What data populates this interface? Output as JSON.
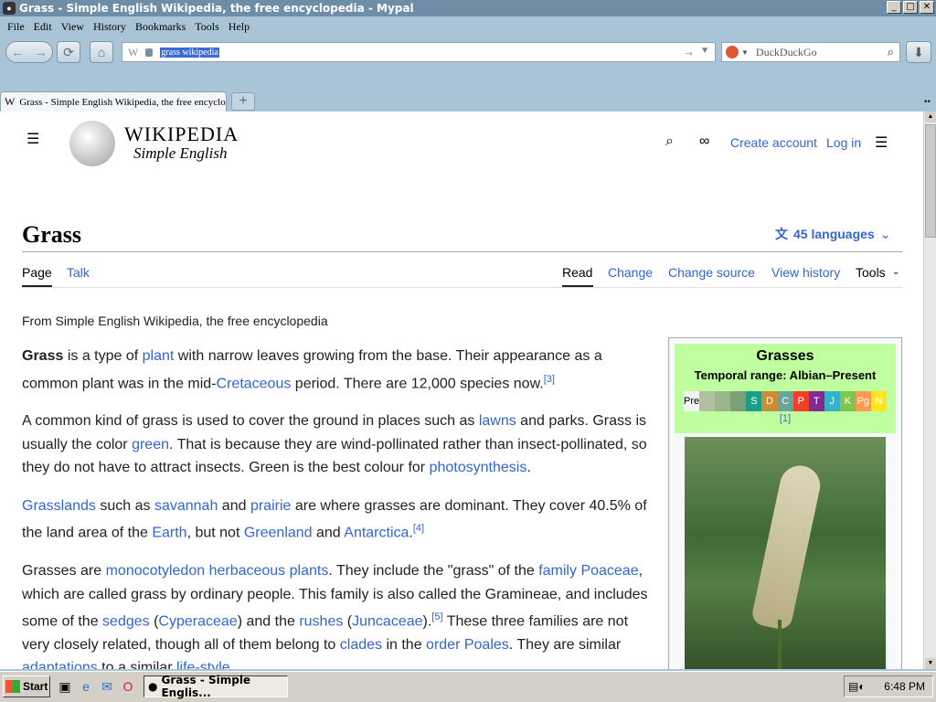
{
  "window": {
    "title": "Grass - Simple English Wikipedia, the free encyclopedia - Mypal",
    "controls": {
      "minimize": "_",
      "maximize": "□",
      "close": "✕"
    }
  },
  "menubar": {
    "items": [
      "File",
      "Edit",
      "View",
      "History",
      "Bookmarks",
      "Tools",
      "Help"
    ]
  },
  "navbar": {
    "url": "grass wikipedia",
    "site_icon": "W",
    "search_placeholder": "DuckDuckGo"
  },
  "tabs": [
    {
      "label": "Grass - Simple English Wikipedia, the free encyclopedia",
      "favicon": "W",
      "active": true
    }
  ],
  "wiki": {
    "wordmark": "WIKIPEDIA",
    "tagline": "Simple English",
    "header_links": {
      "create_account": "Create account",
      "login": "Log in"
    },
    "page_title": "Grass",
    "languages": "45 languages",
    "tabs_left": [
      "Page",
      "Talk"
    ],
    "tabs_right": [
      "Read",
      "Change",
      "Change source",
      "View history",
      "Tools"
    ],
    "from_line": "From Simple English Wikipedia, the free encyclopedia",
    "paragraphs": [
      "<b>Grass</b> is a type of <a>plant</a> with narrow leaves growing from the base. Their appearance as a common plant was in the mid-<a>Cretaceous</a> period. There are 12,000 species now.<sup>[3]</sup>",
      "A common kind of grass is used to cover the ground in places such as <a>lawns</a> and parks. Grass is usually the color <a>green</a>. That is because they are wind-pollinated rather than insect-pollinated, so they do not have to attract insects. Green is the best colour for <a>photosynthesis</a>.",
      "<a>Grasslands</a> such as <a>savannah</a> and <a>prairie</a> are where grasses are dominant. They cover 40.5% of the land area of the <a>Earth</a>, but not <a>Greenland</a> and <a>Antarctica</a>.<sup>[4]</sup>",
      "Grasses are <a>monocotyledon</a> <a>herbaceous</a> <a>plants</a>. They include the \"grass\" of the <a>family</a> <a>Poaceae</a>, which are called grass by ordinary people. This family is also called the Gramineae, and includes some of the <a>sedges</a> (<a>Cyperaceae</a>) and the <a>rushes</a> (<a>Juncaceae</a>).<sup>[5]</sup> These three families are not very closely related, though all of them belong to <a>clades</a> in the <a>order Poales</a>. They are similar <a>adaptations</a> to a similar <a>life-style</a>."
    ],
    "infobox": {
      "title": "Grasses",
      "range": "Temporal range: Albian–Present",
      "timeline": [
        "Pre",
        "",
        "",
        "",
        "S",
        "D",
        "C",
        "P",
        "T",
        "J",
        "K",
        "Pg",
        "N"
      ],
      "timeline_colors": [
        "#f2f2f2",
        "#b0c0a0",
        "#9ab58a",
        "#7aa07a",
        "#1a9e8a",
        "#cb8c37",
        "#67a599",
        "#f04028",
        "#812b92",
        "#34b2c9",
        "#7fc64e",
        "#fd9a52",
        "#ffe619"
      ],
      "ref": "[1]"
    }
  },
  "taskbar": {
    "start": "Start",
    "task": "Grass - Simple Englis...",
    "clock": "6:48 PM"
  },
  "colors": {
    "link": "#3366cc",
    "infobox_header": "#bfff9f",
    "chrome": "#a9c4d6",
    "titlebar": "#6d8ea6"
  }
}
